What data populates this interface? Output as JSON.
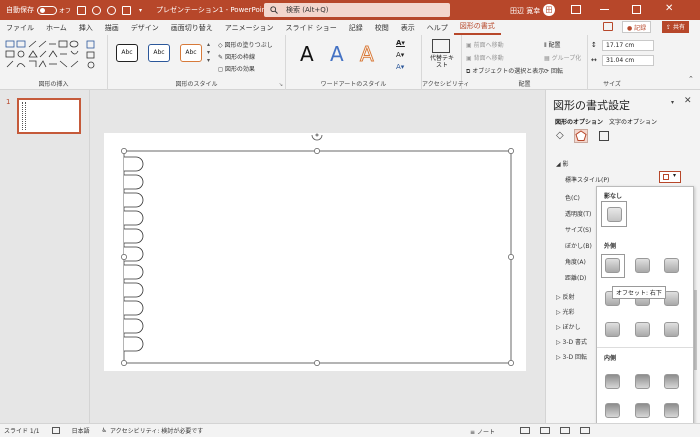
{
  "title_bar": {
    "autosave_label": "自動保存",
    "autosave_state": "オフ",
    "document_title": "プレゼンテーション1 - PowerPoint",
    "search_placeholder": "検索 (Alt+Q)",
    "user_name": "田辺 寛幸",
    "user_initials": "田"
  },
  "tabs": [
    {
      "label": "ファイル"
    },
    {
      "label": "ホーム"
    },
    {
      "label": "挿入"
    },
    {
      "label": "描画"
    },
    {
      "label": "デザイン"
    },
    {
      "label": "画面切り替え"
    },
    {
      "label": "アニメーション"
    },
    {
      "label": "スライド ショー"
    },
    {
      "label": "記録"
    },
    {
      "label": "校閲"
    },
    {
      "label": "表示"
    },
    {
      "label": "ヘルプ"
    },
    {
      "label": "図形の書式",
      "active": true
    }
  ],
  "ribbon_actions": {
    "record": "記録",
    "share": "共有"
  },
  "ribbon": {
    "insert_shapes_label": "図形の挿入",
    "shape_styles": {
      "sample": "Abc",
      "fill": "図形の塗りつぶし",
      "outline": "図形の枠線",
      "effects": "図形の効果",
      "label": "図形のスタイル"
    },
    "wordart": {
      "letter": "A",
      "label": "ワードアートのスタイル"
    },
    "accessibility": {
      "alt_text": "代替テキスト",
      "label": "アクセシビリティ"
    },
    "arrange": {
      "forward": "前面へ移動",
      "backward": "背面へ移動",
      "selection_pane": "オブジェクトの選択と表示",
      "align": "配置",
      "group": "グループ化",
      "rotate": "回転",
      "label": "配置"
    },
    "size": {
      "height": "17.17 cm",
      "width": "31.04 cm",
      "label": "サイズ"
    }
  },
  "slides": {
    "number": "1"
  },
  "format_pane": {
    "title": "図形の書式設定",
    "tab_shape": "図形のオプション",
    "tab_text": "文字のオプション",
    "shadow_section": "影",
    "rows": [
      {
        "label": "標準スタイル(P)"
      },
      {
        "label": "色(C)"
      },
      {
        "label": "透明度(T)"
      },
      {
        "label": "サイズ(S)"
      },
      {
        "label": "ぼかし(B)"
      },
      {
        "label": "角度(A)"
      },
      {
        "label": "距離(D)"
      }
    ],
    "sections": [
      {
        "label": "反射"
      },
      {
        "label": "光彩"
      },
      {
        "label": "ぼかし"
      },
      {
        "label": "3-D 書式"
      },
      {
        "label": "3-D 回転"
      }
    ]
  },
  "shadow_gallery": {
    "none": "影なし",
    "outer": "外側",
    "inner": "内側",
    "tooltip": "オフセット: 右下"
  },
  "status_bar": {
    "slide": "スライド 1/1",
    "language": "日本語",
    "accessibility": "アクセシビリティ: 検討が必要です",
    "notes": "ノート"
  },
  "colors": {
    "accent": "#b7472a"
  }
}
